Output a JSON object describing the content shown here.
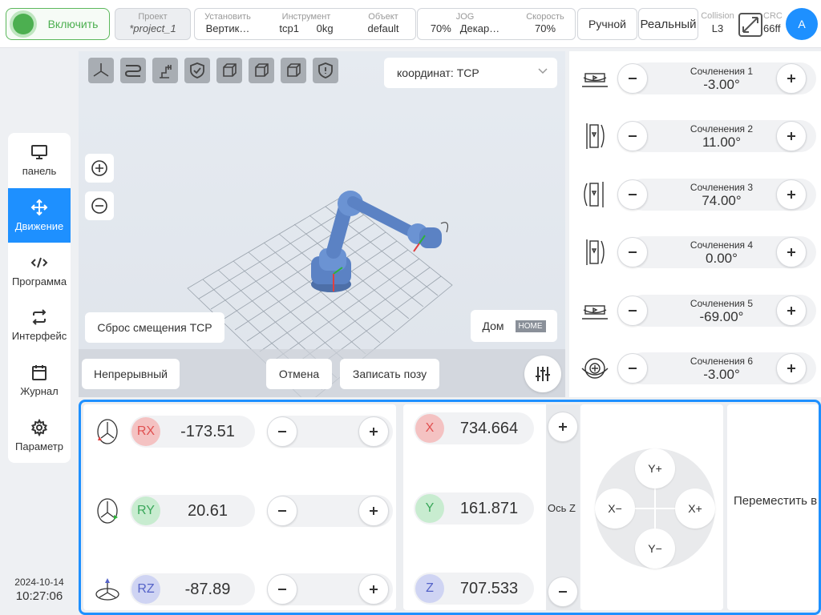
{
  "topbar": {
    "power_label": "Включить",
    "project": {
      "label": "Проект",
      "value": "*project_1"
    },
    "install": {
      "label": "Установить",
      "value": "Вертик…"
    },
    "tool": {
      "label": "Инструмент",
      "tcp": "tcp1",
      "payload": "0kg"
    },
    "object": {
      "label": "Объект",
      "value": "default"
    },
    "jog": {
      "label": "JOG",
      "speed": "70%",
      "frame": "Декар…"
    },
    "speed": {
      "label": "Скорость",
      "value": "70%"
    },
    "mode_manual": "Ручной",
    "mode_real": "Реальный",
    "collision": {
      "label": "Collision",
      "value": "L3"
    },
    "crc": {
      "label": "CRC",
      "value": "66ff"
    },
    "avatar": "A"
  },
  "nav": {
    "items": [
      {
        "label": "панель",
        "icon": "monitor-icon"
      },
      {
        "label": "Движение",
        "icon": "move-arrows-icon",
        "active": true
      },
      {
        "label": "Программа",
        "icon": "code-icon"
      },
      {
        "label": "Интерфейс",
        "icon": "swap-icon"
      },
      {
        "label": "Журнал",
        "icon": "calendar-icon"
      },
      {
        "label": "Параметр",
        "icon": "gear-icon"
      }
    ]
  },
  "datetime": {
    "date": "2024-10-14",
    "time": "10:27:06"
  },
  "viewport": {
    "coord_select": "координат: TCP",
    "reset_tcp": "Сброс смещения TCP",
    "home_label": "Дом",
    "home_badge": "HOME",
    "continuous": "Непрерывный",
    "cancel": "Отмена",
    "record_pose": "Записать позу"
  },
  "joints": [
    {
      "label": "Сочленения 1",
      "value": "-3.00°"
    },
    {
      "label": "Сочленения 2",
      "value": "11.00°"
    },
    {
      "label": "Сочленения 3",
      "value": "74.00°"
    },
    {
      "label": "Сочленения 4",
      "value": "0.00°"
    },
    {
      "label": "Сочленения 5",
      "value": "-69.00°"
    },
    {
      "label": "Сочленения 6",
      "value": "-3.00°"
    }
  ],
  "rotation": [
    {
      "axis": "RX",
      "value": "-173.51",
      "color": "#f4a3a3",
      "text_color": "#e05050"
    },
    {
      "axis": "RY",
      "value": "20.61",
      "color": "#b9e6c3",
      "text_color": "#3aa75a"
    },
    {
      "axis": "RZ",
      "value": "-87.89",
      "color": "#c3c9f0",
      "text_color": "#5563c8"
    }
  ],
  "translation": [
    {
      "axis": "X",
      "value": "734.664",
      "color": "#f4a3a3",
      "text_color": "#e05050"
    },
    {
      "axis": "Y",
      "value": "161.871",
      "color": "#b9e6c3",
      "text_color": "#3aa75a"
    },
    {
      "axis": "Z",
      "value": "707.533",
      "color": "#c3c9f0",
      "text_color": "#5563c8"
    }
  ],
  "z_axis_label": "Ось Z",
  "xy_pad": {
    "up": "Y+",
    "down": "Y−",
    "left": "X−",
    "right": "X+"
  },
  "move_to": "Переместить в",
  "colors": {
    "accent": "#1e90ff",
    "power": "#4caf50"
  }
}
